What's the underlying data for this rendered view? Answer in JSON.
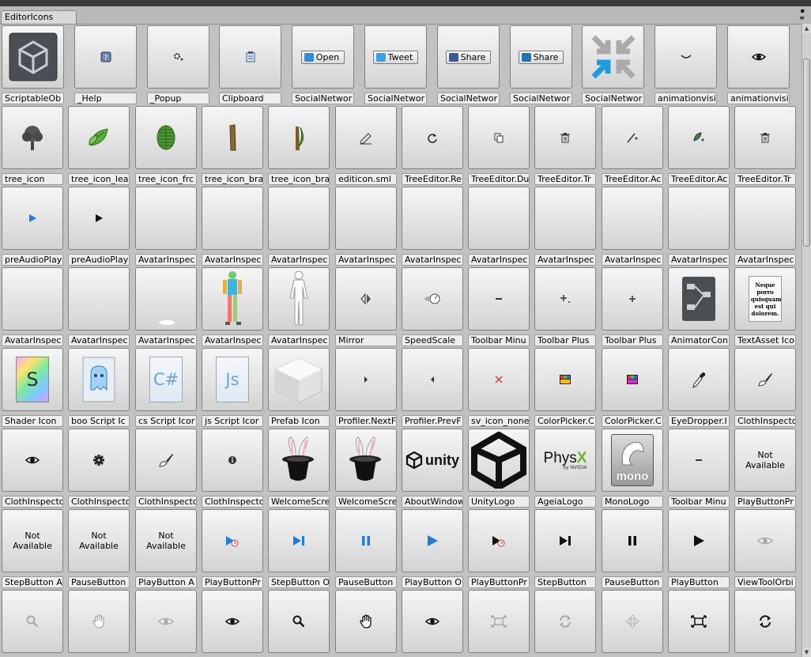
{
  "window": {
    "tab_title": "EditorIcons",
    "controls": [
      "▪",
      "≡"
    ]
  },
  "rows": [
    [
      {
        "label": "ScriptableOb",
        "icon": "unity-logo-tile-icon"
      },
      {
        "label": "_Help",
        "icon": "help-icon"
      },
      {
        "label": "_Popup",
        "icon": "popup-gear-icon"
      },
      {
        "label": "Clipboard",
        "icon": "clipboard-icon"
      },
      {
        "label": "SocialNetwor",
        "icon": "open-button-icon",
        "text": "Open"
      },
      {
        "label": "SocialNetwor",
        "icon": "tweet-button-icon",
        "text": "Tweet"
      },
      {
        "label": "SocialNetwor",
        "icon": "facebook-share-icon",
        "text": "Share"
      },
      {
        "label": "SocialNetwor",
        "icon": "linkedin-share-icon",
        "text": "Share"
      },
      {
        "label": "SocialNetwor",
        "icon": "arrows-compress-icon"
      },
      {
        "label": "animationvisi",
        "icon": "eye-closed-icon"
      },
      {
        "label": "animationvisi",
        "icon": "eye-open-icon"
      }
    ],
    [
      {
        "label": "tree_icon",
        "icon": "tree-icon"
      },
      {
        "label": "tree_icon_lea",
        "icon": "leaf-icon"
      },
      {
        "label": "tree_icon_frc",
        "icon": "frond-icon"
      },
      {
        "label": "tree_icon_bra",
        "icon": "branch-icon"
      },
      {
        "label": "tree_icon_bra",
        "icon": "branch-leaves-icon"
      },
      {
        "label": "editicon.sml",
        "icon": "pencil-icon"
      },
      {
        "label": "TreeEditor.Re",
        "icon": "refresh-icon"
      },
      {
        "label": "TreeEditor.Du",
        "icon": "duplicate-icon"
      },
      {
        "label": "TreeEditor.Tr",
        "icon": "trash-icon"
      },
      {
        "label": "TreeEditor.Ac",
        "icon": "add-branch-icon"
      },
      {
        "label": "TreeEditor.Ac",
        "icon": "add-leaf-icon"
      },
      {
        "label": "TreeEditor.Tr",
        "icon": "trash-icon"
      }
    ],
    [
      {
        "label": "preAudioPlay",
        "icon": "play-blue-icon"
      },
      {
        "label": "preAudioPlay",
        "icon": "play-black-icon"
      },
      {
        "label": "AvatarInspec",
        "icon": "faint-dot-icon"
      },
      {
        "label": "AvatarInspec",
        "icon": "faint-dot-icon"
      },
      {
        "label": "AvatarInspec",
        "icon": "faint-dot-icon"
      },
      {
        "label": "AvatarInspec",
        "icon": "faint-dot-icon"
      },
      {
        "label": "AvatarInspec",
        "icon": "faint-dot-icon"
      },
      {
        "label": "AvatarInspec",
        "icon": "faint-dot-icon"
      },
      {
        "label": "AvatarInspec",
        "icon": "faint-dot-icon"
      },
      {
        "label": "AvatarInspec",
        "icon": "faint-dot-icon"
      },
      {
        "label": "AvatarInspec",
        "icon": "faint-line-icon"
      },
      {
        "label": "AvatarInspec",
        "icon": "faint-line-icon"
      }
    ],
    [
      {
        "label": "AvatarInspec",
        "icon": "faint-dot-icon"
      },
      {
        "label": "AvatarInspec",
        "icon": "faint-line-icon"
      },
      {
        "label": "AvatarInspec",
        "icon": "shadow-ellipse-icon"
      },
      {
        "label": "AvatarInspec",
        "icon": "avatar-colored-icon"
      },
      {
        "label": "AvatarInspec",
        "icon": "avatar-white-icon"
      },
      {
        "label": "Mirror",
        "icon": "mirror-icon"
      },
      {
        "label": "SpeedScale",
        "icon": "speed-scale-icon"
      },
      {
        "label": "Toolbar Minu",
        "icon": "minus-icon"
      },
      {
        "label": "Toolbar Plus",
        "icon": "plus-more-icon"
      },
      {
        "label": "Toolbar Plus",
        "icon": "plus-icon"
      },
      {
        "label": "AnimatorCon",
        "icon": "animator-controller-icon"
      },
      {
        "label": "TextAsset Ico",
        "icon": "text-asset-icon",
        "text": "Neque porro quisquam est qui dolorem."
      }
    ],
    [
      {
        "label": "Shader Icon",
        "icon": "shader-file-icon",
        "text": "S"
      },
      {
        "label": "boo Script Ic",
        "icon": "boo-script-icon"
      },
      {
        "label": "cs Script Icor",
        "icon": "cs-script-icon",
        "text": "C#"
      },
      {
        "label": "js Script Icor",
        "icon": "js-script-icon",
        "text": "Js"
      },
      {
        "label": "Prefab Icon",
        "icon": "prefab-cube-icon"
      },
      {
        "label": "Profiler.NextF",
        "icon": "next-frame-icon"
      },
      {
        "label": "Profiler.PrevF",
        "icon": "prev-frame-icon"
      },
      {
        "label": "sv_icon_none",
        "icon": "none-x-icon"
      },
      {
        "label": "ColorPicker.C",
        "icon": "color-picker-icon"
      },
      {
        "label": "ColorPicker.C",
        "icon": "color-picker-alt-icon"
      },
      {
        "label": "EyeDropper.I",
        "icon": "eyedropper-icon"
      },
      {
        "label": "ClothInspecto",
        "icon": "paintbrush-icon"
      }
    ],
    [
      {
        "label": "ClothInspecto",
        "icon": "eye-icon"
      },
      {
        "label": "ClothInspecto",
        "icon": "gear-icon"
      },
      {
        "label": "ClothInspecto",
        "icon": "paintbrush-icon"
      },
      {
        "label": "ClothInspecto",
        "icon": "info-icon"
      },
      {
        "label": "WelcomeScre",
        "icon": "magic-hat-rabbit-icon"
      },
      {
        "label": "WelcomeScre",
        "icon": "magic-hat-rabbit-icon"
      },
      {
        "label": "AboutWindow",
        "icon": "unity-wordmark-icon",
        "text": "unity"
      },
      {
        "label": "UnityLogo",
        "icon": "unity-cube-logo-icon"
      },
      {
        "label": "AgeiaLogo",
        "icon": "physx-logo-icon",
        "text": "PhysX",
        "sub": "by NVIDIA"
      },
      {
        "label": "MonoLogo",
        "icon": "mono-logo-icon",
        "text": "mono"
      },
      {
        "label": "Toolbar Minu",
        "icon": "minus-icon"
      },
      {
        "label": "PlayButtonPr",
        "icon": "not-available",
        "text": "Not Available"
      }
    ],
    [
      {
        "label": "StepButton A",
        "icon": "not-available",
        "text": "Not Available"
      },
      {
        "label": "PauseButton",
        "icon": "not-available",
        "text": "Not Available"
      },
      {
        "label": "PlayButton A",
        "icon": "not-available",
        "text": "Not Available"
      },
      {
        "label": "PlayButtonPr",
        "icon": "play-profile-blue-icon"
      },
      {
        "label": "StepButton O",
        "icon": "step-blue-icon"
      },
      {
        "label": "PauseButton",
        "icon": "pause-blue-icon"
      },
      {
        "label": "PlayButton O",
        "icon": "play-blue-large-icon"
      },
      {
        "label": "PlayButtonPr",
        "icon": "play-profile-icon"
      },
      {
        "label": "StepButton",
        "icon": "step-icon"
      },
      {
        "label": "PauseButton",
        "icon": "pause-icon"
      },
      {
        "label": "PlayButton",
        "icon": "play-icon"
      },
      {
        "label": "ViewToolOrbi",
        "icon": "orbit-eye-faint-icon"
      }
    ],
    [
      {
        "label": "",
        "icon": "zoom-faint-icon"
      },
      {
        "label": "",
        "icon": "hand-faint-icon"
      },
      {
        "label": "",
        "icon": "eye-faint-icon"
      },
      {
        "label": "",
        "icon": "eye-icon"
      },
      {
        "label": "",
        "icon": "zoom-icon"
      },
      {
        "label": "",
        "icon": "hand-icon"
      },
      {
        "label": "",
        "icon": "eye-icon"
      },
      {
        "label": "",
        "icon": "frame-select-faint-icon"
      },
      {
        "label": "",
        "icon": "rotate-faint-icon"
      },
      {
        "label": "",
        "icon": "move-faint-icon"
      },
      {
        "label": "",
        "icon": "frame-select-icon"
      },
      {
        "label": "",
        "icon": "rotate-icon"
      }
    ]
  ]
}
